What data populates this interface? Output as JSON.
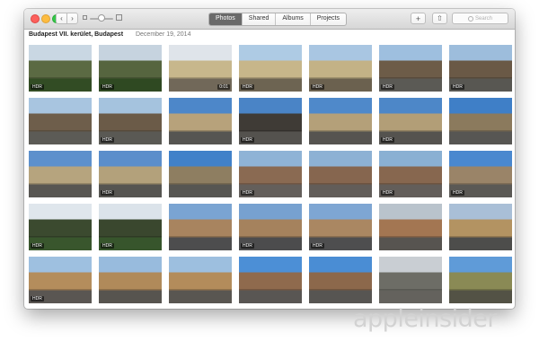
{
  "toolbar": {
    "nav_back": "‹",
    "nav_fwd": "›",
    "tabs": [
      {
        "label": "Photos",
        "active": true
      },
      {
        "label": "Shared",
        "active": false
      },
      {
        "label": "Albums",
        "active": false
      },
      {
        "label": "Projects",
        "active": false
      }
    ],
    "add_label": "+",
    "share_label": "⇧",
    "search_placeholder": "Search"
  },
  "moment": {
    "place": "Budapest VII. kerület, Budapest",
    "date": "December 19, 2014"
  },
  "photos": [
    {
      "sky": "#c9d7e3",
      "mid": "#5b6a43",
      "gr": "#3e5d2c",
      "badge": "HDR"
    },
    {
      "sky": "#c6d3df",
      "mid": "#56653f",
      "gr": "#3a592a",
      "badge": "HDR"
    },
    {
      "sky": "#dfe4ea",
      "mid": "#c7b78c",
      "gr": "#8a7f6d",
      "badge": "0:01",
      "kind": "video"
    },
    {
      "sky": "#aecbe4",
      "mid": "#c7b68a",
      "gr": "#867a64",
      "badge": "HDR"
    },
    {
      "sky": "#a9c6e2",
      "mid": "#c3b286",
      "gr": "#837761",
      "badge": "HDR"
    },
    {
      "sky": "#9ebfdf",
      "mid": "#6d5c48",
      "gr": "#6f6e68",
      "badge": "HDR"
    },
    {
      "sky": "#9dbddc",
      "mid": "#6a5946",
      "gr": "#6c6b65",
      "badge": "HDR"
    },
    {
      "sky": "#a8c5e0",
      "mid": "#6e5e4b",
      "gr": "#71706a",
      "badge": ""
    },
    {
      "sky": "#a5c3de",
      "mid": "#6b5b48",
      "gr": "#6e6d67",
      "badge": "HDR"
    },
    {
      "sky": "#4d87c9",
      "mid": "#b7a27b",
      "gr": "#6a6864",
      "badge": ""
    },
    {
      "sky": "#4a84c6",
      "mid": "#3f3b36",
      "gr": "#676560",
      "badge": "HDR"
    },
    {
      "sky": "#4f89ca",
      "mid": "#b4a079",
      "gr": "#696762",
      "badge": ""
    },
    {
      "sky": "#4d87c8",
      "mid": "#b29e77",
      "gr": "#686661",
      "badge": "HDR"
    },
    {
      "sky": "#3f7fc7",
      "mid": "#8b7a5d",
      "gr": "#6b6a66",
      "badge": ""
    },
    {
      "sky": "#5d90cc",
      "mid": "#b6a47e",
      "gr": "#6c6a65",
      "badge": ""
    },
    {
      "sky": "#5b8ecb",
      "mid": "#b3a17b",
      "gr": "#6a6863",
      "badge": "HDR"
    },
    {
      "sky": "#4181c9",
      "mid": "#8e7e61",
      "gr": "#6b6965",
      "badge": ""
    },
    {
      "sky": "#8fb3d6",
      "mid": "#8a6a52",
      "gr": "#7b7570",
      "badge": "HDR"
    },
    {
      "sky": "#8db1d4",
      "mid": "#86664f",
      "gr": "#78726d",
      "badge": ""
    },
    {
      "sky": "#8ab0d3",
      "mid": "#87674f",
      "gr": "#79736e",
      "badge": "HDR"
    },
    {
      "sky": "#4a88cf",
      "mid": "#9a8468",
      "gr": "#6f6d68",
      "badge": "HDR"
    },
    {
      "sky": "#dfe6ec",
      "mid": "#3b4a2f",
      "gr": "#466a37",
      "badge": "HDR"
    },
    {
      "sky": "#dbe3ea",
      "mid": "#3a472e",
      "gr": "#446836",
      "badge": "HDR"
    },
    {
      "sky": "#7aa4d2",
      "mid": "#a8845f",
      "gr": "#5f5f60",
      "badge": ""
    },
    {
      "sky": "#77a1d0",
      "mid": "#a5825d",
      "gr": "#5d5d5e",
      "badge": "HDR"
    },
    {
      "sky": "#7ea6d3",
      "mid": "#aa8762",
      "gr": "#606061",
      "badge": "HDR"
    },
    {
      "sky": "#b9c3cc",
      "mid": "#a37652",
      "gr": "#6b6762",
      "badge": ""
    },
    {
      "sky": "#a9bfd7",
      "mid": "#b39362",
      "gr": "#5f5e5c",
      "badge": ""
    },
    {
      "sky": "#9ec0e0",
      "mid": "#b48d5c",
      "gr": "#6e6a64",
      "badge": "HDR"
    },
    {
      "sky": "#98bbdd",
      "mid": "#b08a5a",
      "gr": "#6b6761",
      "badge": ""
    },
    {
      "sky": "#9dbfdf",
      "mid": "#b38c5b",
      "gr": "#6d6963",
      "badge": ""
    },
    {
      "sky": "#4c8fd6",
      "mid": "#8f6a4d",
      "gr": "#6d6a66",
      "badge": ""
    },
    {
      "sky": "#4a8dd4",
      "mid": "#8c684b",
      "gr": "#6b6864",
      "badge": ""
    },
    {
      "sky": "#c9ced3",
      "mid": "#6d6d66",
      "gr": "#7b7872",
      "badge": ""
    },
    {
      "sky": "#5f9bd8",
      "mid": "#8a8a55",
      "gr": "#666455",
      "badge": ""
    }
  ],
  "watermark": "appleinsider"
}
